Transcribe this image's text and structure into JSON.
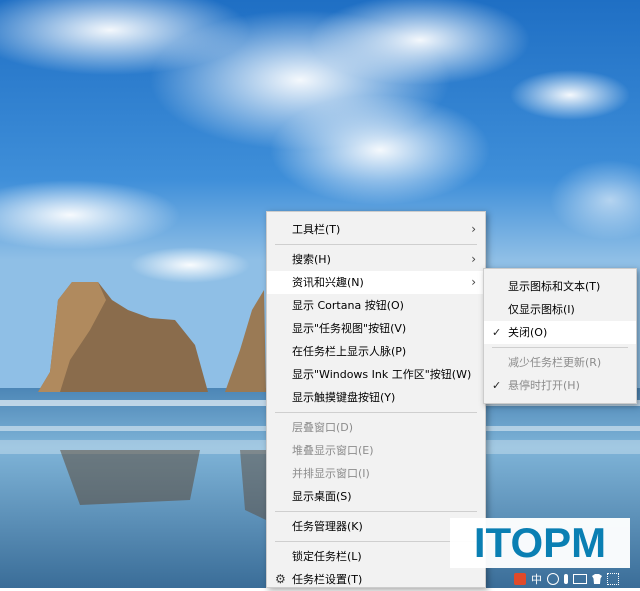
{
  "main_menu": {
    "items": [
      {
        "label": "工具栏(T)",
        "submenu": true,
        "disabled": false
      },
      {
        "sep": true
      },
      {
        "label": "搜索(H)",
        "submenu": true,
        "disabled": false
      },
      {
        "label": "资讯和兴趣(N)",
        "submenu": true,
        "disabled": false,
        "highlighted": true
      },
      {
        "label": "显示 Cortana 按钮(O)",
        "disabled": false
      },
      {
        "label": "显示\"任务视图\"按钮(V)",
        "disabled": false
      },
      {
        "label": "在任务栏上显示人脉(P)",
        "disabled": false
      },
      {
        "label": "显示\"Windows Ink 工作区\"按钮(W)",
        "disabled": false
      },
      {
        "label": "显示触摸键盘按钮(Y)",
        "disabled": false
      },
      {
        "sep": true
      },
      {
        "label": "层叠窗口(D)",
        "disabled": true
      },
      {
        "label": "堆叠显示窗口(E)",
        "disabled": true
      },
      {
        "label": "并排显示窗口(I)",
        "disabled": true
      },
      {
        "label": "显示桌面(S)",
        "disabled": false
      },
      {
        "sep": true
      },
      {
        "label": "任务管理器(K)",
        "disabled": false
      },
      {
        "sep": true
      },
      {
        "label": "锁定任务栏(L)",
        "disabled": false
      },
      {
        "label": "任务栏设置(T)",
        "disabled": false,
        "icon": "gear-icon"
      }
    ]
  },
  "sub_menu": {
    "items": [
      {
        "label": "显示图标和文本(T)",
        "disabled": false
      },
      {
        "label": "仅显示图标(I)",
        "disabled": false
      },
      {
        "label": "关闭(O)",
        "disabled": false,
        "checked": true,
        "highlighted": true
      },
      {
        "sep": true
      },
      {
        "label": "减少任务栏更新(R)",
        "disabled": true
      },
      {
        "label": "悬停时打开(H)",
        "disabled": true,
        "checked": true
      }
    ]
  },
  "watermark": {
    "text": "ITOPM",
    "color": "#0a7fb3"
  },
  "tray": {
    "ime_label": "中"
  },
  "icons": {
    "arrow": "›",
    "check": "✓",
    "gear": "⚙"
  }
}
